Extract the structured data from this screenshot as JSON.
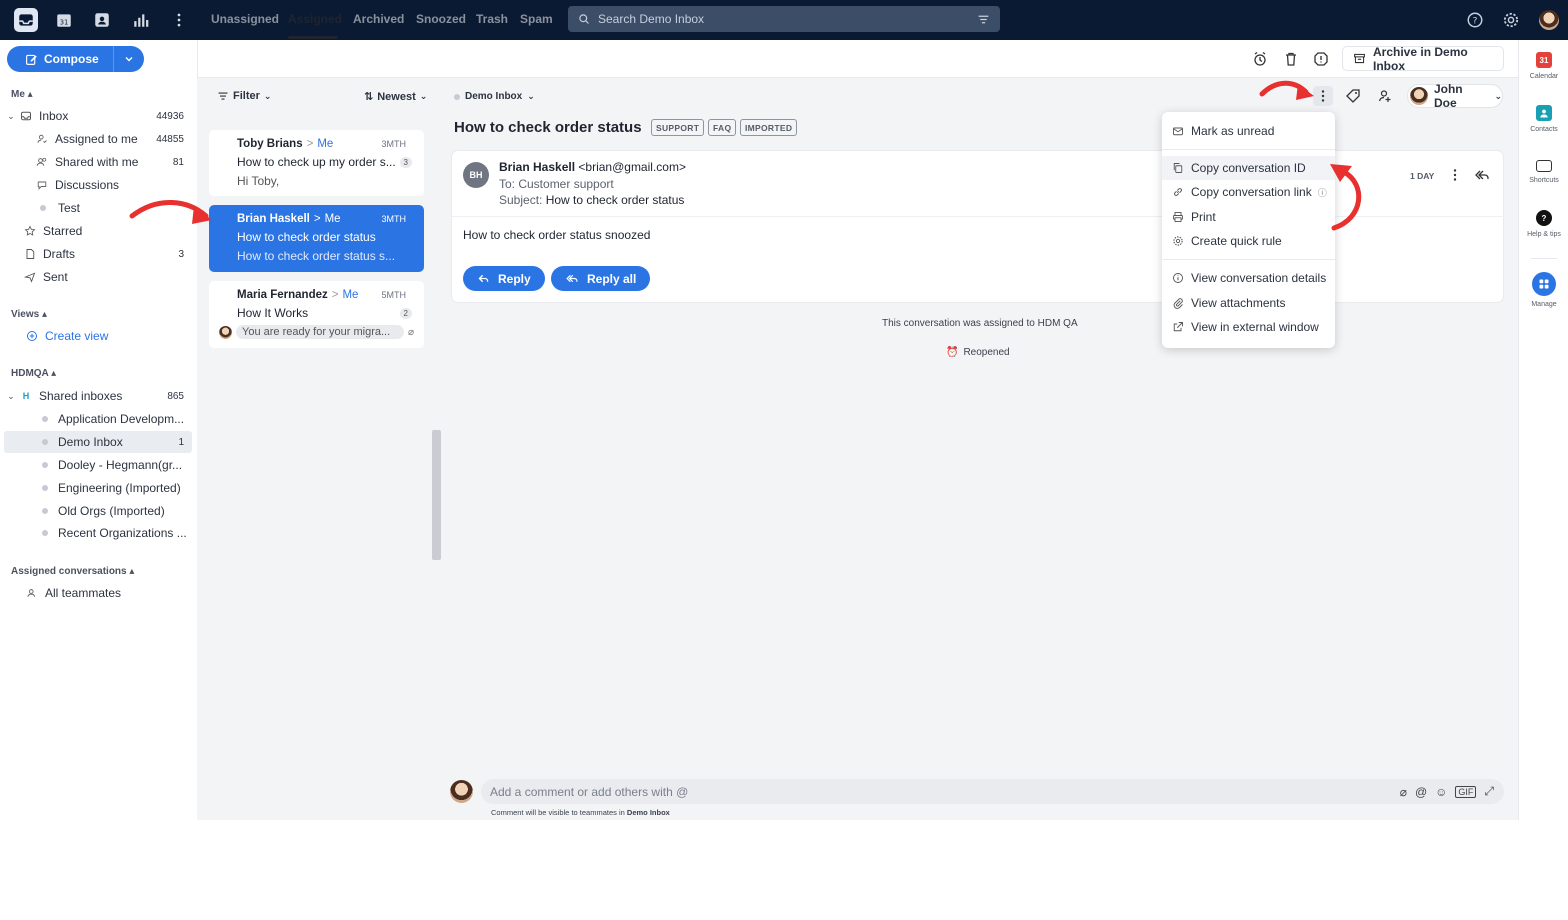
{
  "search": {
    "placeholder": "Search Demo Inbox"
  },
  "compose": {
    "label": "Compose"
  },
  "me_section": {
    "heading": "Me",
    "items": [
      {
        "label": "Inbox",
        "count": "44936"
      },
      {
        "label": "Assigned to me",
        "count": "44855"
      },
      {
        "label": "Shared with me",
        "count": "81"
      },
      {
        "label": "Discussions",
        "count": ""
      },
      {
        "label": "Test",
        "count": ""
      },
      {
        "label": "Starred",
        "count": ""
      },
      {
        "label": "Drafts",
        "count": "3"
      },
      {
        "label": "Sent",
        "count": ""
      }
    ]
  },
  "views": {
    "heading": "Views",
    "create": "Create view"
  },
  "hdmqa": {
    "heading": "HDMQA",
    "shared_label": "Shared inboxes",
    "shared_badge": "H",
    "shared_count": "865",
    "items": [
      {
        "label": "Application Developm...",
        "count": ""
      },
      {
        "label": "Demo Inbox",
        "count": "1"
      },
      {
        "label": "Dooley - Hegmann(gr...",
        "count": ""
      },
      {
        "label": "Engineering (Imported)",
        "count": ""
      },
      {
        "label": "Old Orgs (Imported)",
        "count": ""
      },
      {
        "label": "Recent Organizations ...",
        "count": ""
      }
    ]
  },
  "assigned_conv": {
    "heading": "Assigned conversations",
    "all": "All teammates"
  },
  "tabs": [
    "Unassigned",
    "Assigned",
    "Archived",
    "Snoozed",
    "Trash",
    "Spam"
  ],
  "archive_button": "Archive in Demo Inbox",
  "list": {
    "filter": "Filter",
    "sort": "Newest",
    "cards": [
      {
        "from": "Toby Brians",
        "to": "Me",
        "time": "3MTH",
        "subject": "How to check up my order s...",
        "count": "3",
        "preview": "Hi Toby,"
      },
      {
        "from": "Brian Haskell",
        "to": "Me",
        "time": "3MTH",
        "subject": "How to check order status",
        "count": "",
        "preview": "How to check order status s..."
      },
      {
        "from": "Maria Fernandez",
        "to": "Me",
        "time": "5MTH",
        "subject": "How It Works",
        "count": "2",
        "preview": "You are ready for your migra..."
      }
    ]
  },
  "conversation": {
    "inbox": "Demo Inbox",
    "title": "How to check order status",
    "tags": [
      "SUPPORT",
      "FAQ",
      "IMPORTED"
    ],
    "assignee": "John Doe",
    "avatar_initials": "BH",
    "from_name": "Brian Haskell",
    "from_email": "<brian@gmail.com>",
    "to": "To: Customer support",
    "subject_label": "Subject:",
    "subject": "How to check order status",
    "time": "1 DAY",
    "body": "How to check order status snoozed",
    "reply": "Reply",
    "reply_all": "Reply all",
    "system_assigned": "This conversation was assigned to HDM QA",
    "system_reopened": "Reopened",
    "comment_placeholder": "Add a comment or add others with @",
    "comment_note_prefix": "Comment will be visible to teammates in",
    "comment_note_inbox": "Demo Inbox"
  },
  "menu": {
    "items": [
      "Mark as unread",
      "Copy conversation ID",
      "Copy conversation link",
      "Print",
      "Create quick rule",
      "View conversation details",
      "View attachments",
      "View in external window"
    ]
  },
  "rightbar": {
    "items": [
      {
        "label": "Calendar",
        "glyph": "31"
      },
      {
        "label": "Contacts",
        "glyph": ""
      },
      {
        "label": "Shortcuts",
        "glyph": ""
      },
      {
        "label": "Help & tips",
        "glyph": "?"
      },
      {
        "label": "Manage",
        "glyph": ""
      }
    ]
  },
  "colors": {
    "accent": "#2b74e4",
    "topbar": "#0b1a33",
    "annotation": "#e8302f"
  }
}
